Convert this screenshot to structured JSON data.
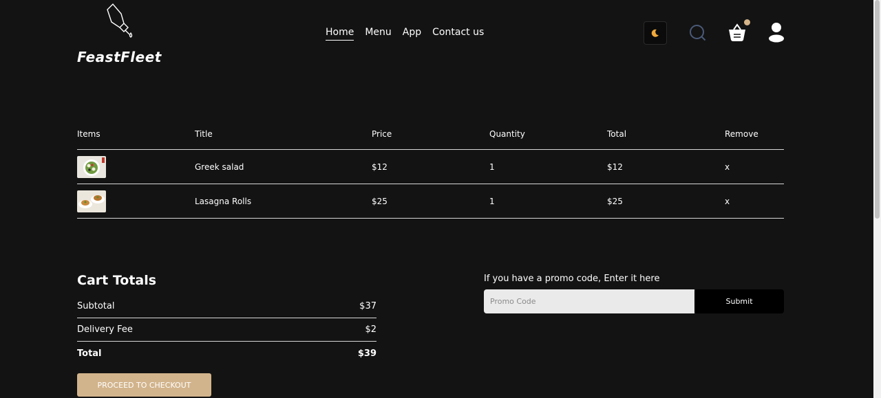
{
  "brand": {
    "name": "FeastFleet"
  },
  "nav": {
    "items": [
      "Home",
      "Menu",
      "App",
      "Contact us"
    ],
    "active": "Home"
  },
  "header_icons": [
    "moon-icon",
    "search-icon",
    "basket-icon",
    "user-icon"
  ],
  "table": {
    "headers": [
      "Items",
      "Title",
      "Price",
      "Quantity",
      "Total",
      "Remove"
    ],
    "rows": [
      {
        "title": "Greek salad",
        "price": "$12",
        "quantity": "1",
        "total": "$12",
        "remove": "x"
      },
      {
        "title": "Lasagna Rolls",
        "price": "$25",
        "quantity": "1",
        "total": "$25",
        "remove": "x"
      }
    ]
  },
  "totals": {
    "heading": "Cart Totals",
    "subtotal_label": "Subtotal",
    "subtotal": "$37",
    "delivery_label": "Delivery Fee",
    "delivery": "$2",
    "total_label": "Total",
    "total": "$39",
    "checkout_label": "PROCEED TO CHECKOUT"
  },
  "promo": {
    "prompt": "If you have a promo code, Enter it here",
    "placeholder": "Promo Code",
    "submit_label": "Submit"
  },
  "colors": {
    "background": "#131313",
    "accent": "#d2b48c",
    "text": "#ffffff"
  }
}
